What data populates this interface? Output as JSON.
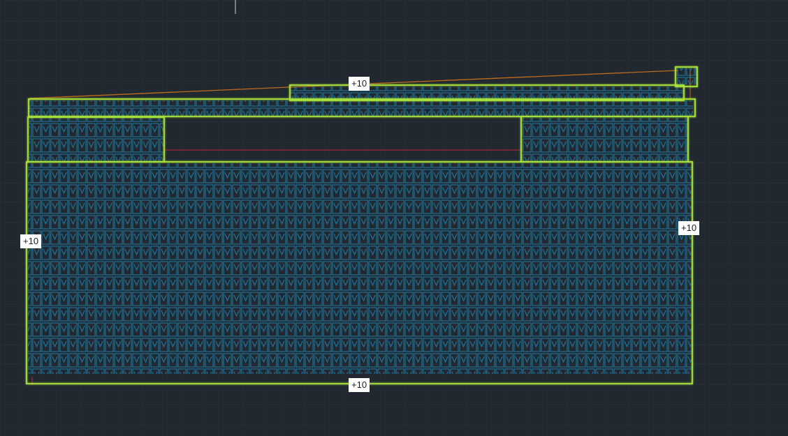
{
  "viewport": {
    "background": "#212830",
    "grid_color": "#2c3440",
    "region_outline_color": "#a8e33a",
    "tile_color": "#1d7ea6",
    "slope_line_color": "#c26a1a",
    "axis_line_color": "#c0283c"
  },
  "level_tags": [
    {
      "label": "+10",
      "name": "level-tag-top"
    },
    {
      "label": "+10",
      "name": "level-tag-left"
    },
    {
      "label": "+10",
      "name": "level-tag-right"
    },
    {
      "label": "+10",
      "name": "level-tag-bottom"
    }
  ]
}
